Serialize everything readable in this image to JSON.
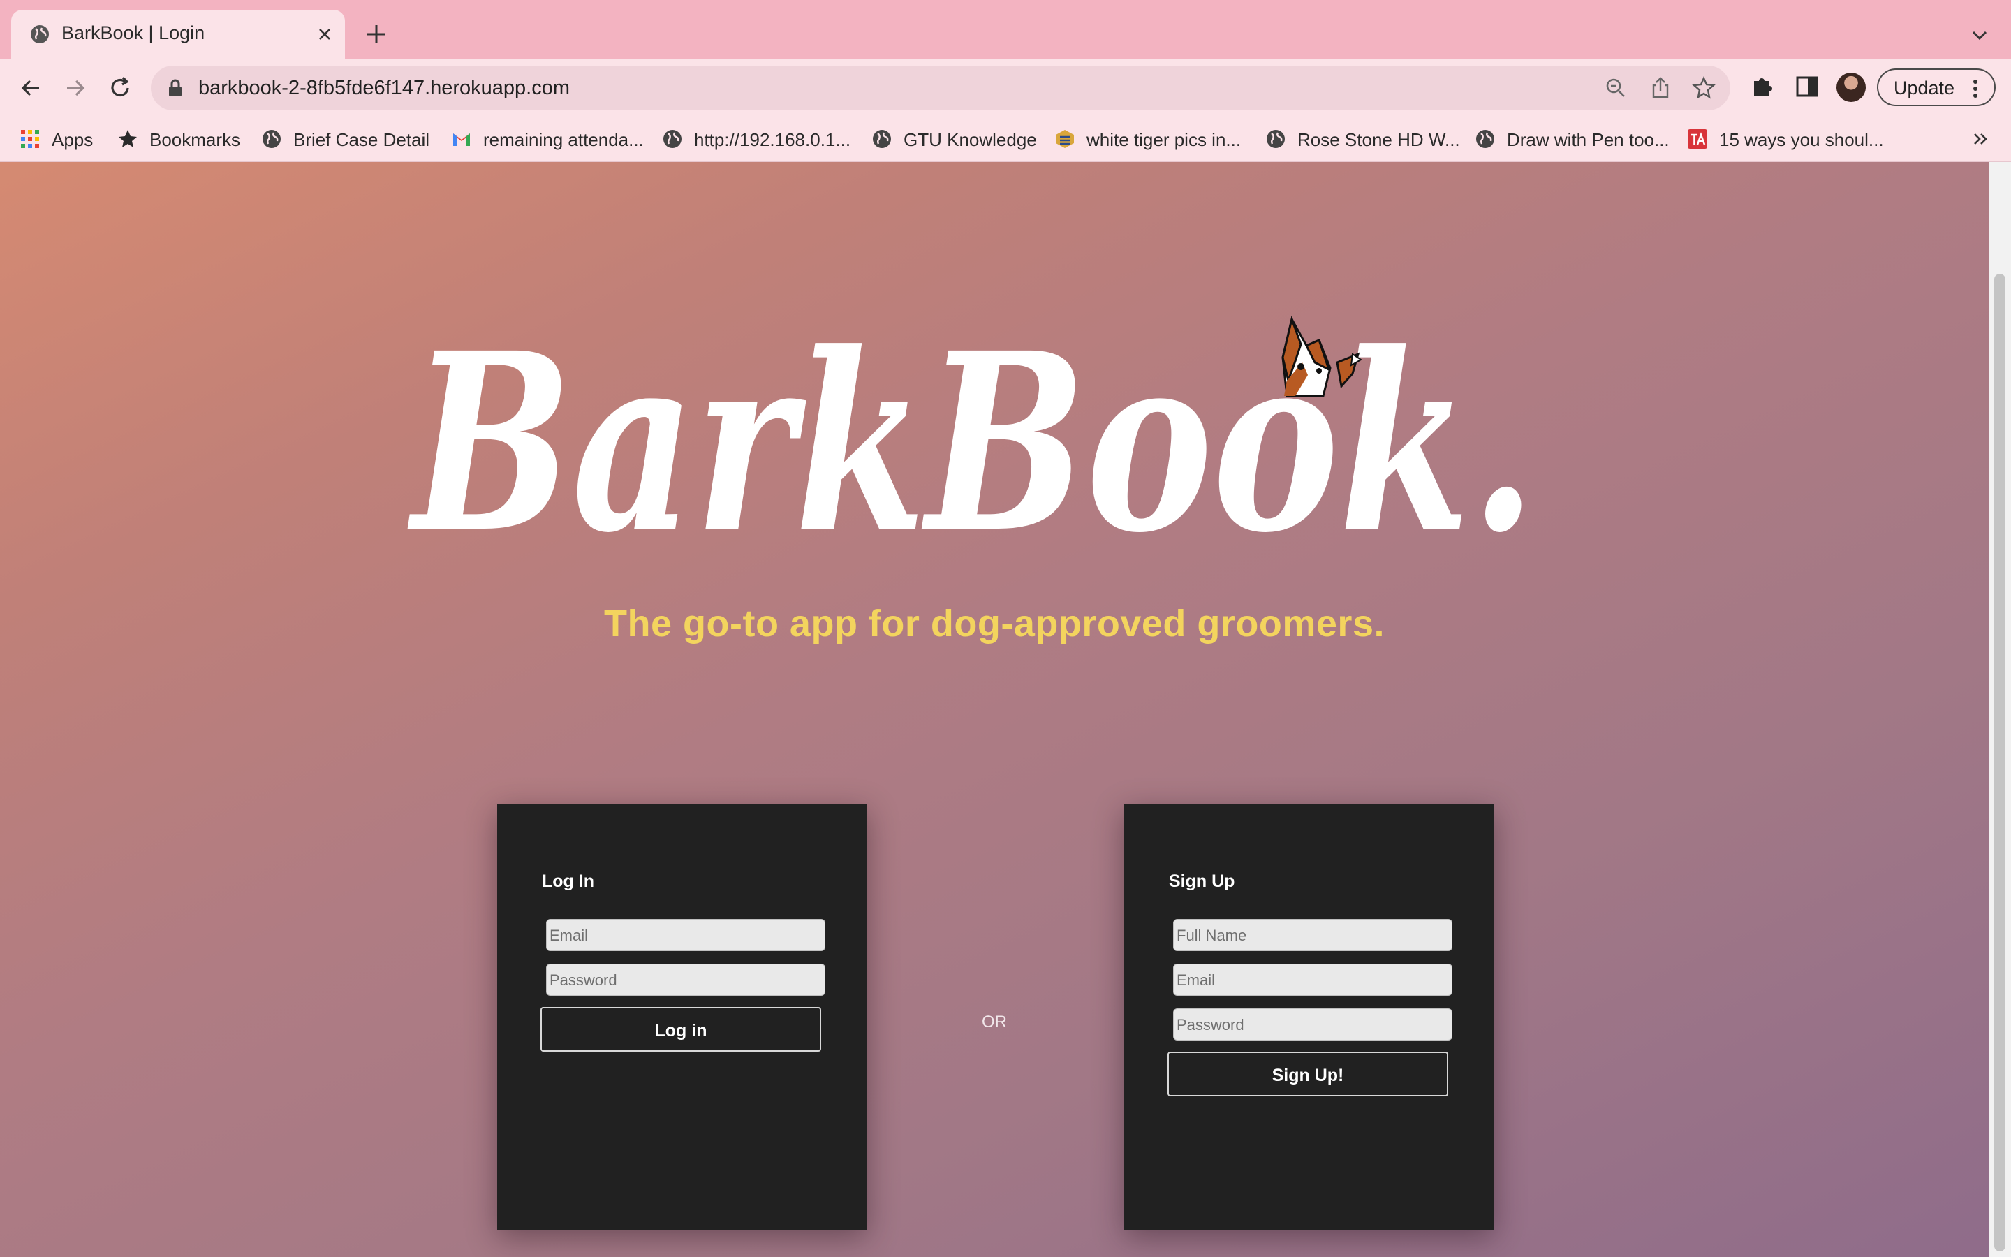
{
  "browser": {
    "tab_title": "BarkBook | Login",
    "url": "barkbook-2-8fb5fde6f147.herokuapp.com",
    "update_label": "Update",
    "bookmarks": [
      {
        "label": "Apps",
        "icon": "apps-grid-icon"
      },
      {
        "label": "Bookmarks",
        "icon": "star-icon"
      },
      {
        "label": "Brief Case Detail",
        "icon": "globe-icon"
      },
      {
        "label": "remaining attenda...",
        "icon": "gmail-icon"
      },
      {
        "label": "http://192.168.0.1...",
        "icon": "globe-icon"
      },
      {
        "label": "GTU Knowledge",
        "icon": "globe-icon"
      },
      {
        "label": "white tiger pics in...",
        "icon": "site-icon"
      },
      {
        "label": "Rose Stone HD W...",
        "icon": "globe-icon"
      },
      {
        "label": "Draw with Pen too...",
        "icon": "globe-icon"
      },
      {
        "label": "15 ways you shoul...",
        "icon": "ta-icon"
      }
    ]
  },
  "page": {
    "logo_text": "BarkBook.",
    "tagline": "The go-to app for dog-approved groomers.",
    "separator": "OR",
    "login": {
      "heading": "Log In",
      "email_placeholder": "Email",
      "password_placeholder": "Password",
      "button_label": "Log in"
    },
    "signup": {
      "heading": "Sign Up",
      "fullname_placeholder": "Full Name",
      "email_placeholder": "Email",
      "password_placeholder": "Password",
      "button_label": "Sign Up!"
    }
  },
  "colors": {
    "tagline": "#f3d45e",
    "card": "#212121",
    "tabstrip": "#f3b3c1"
  }
}
